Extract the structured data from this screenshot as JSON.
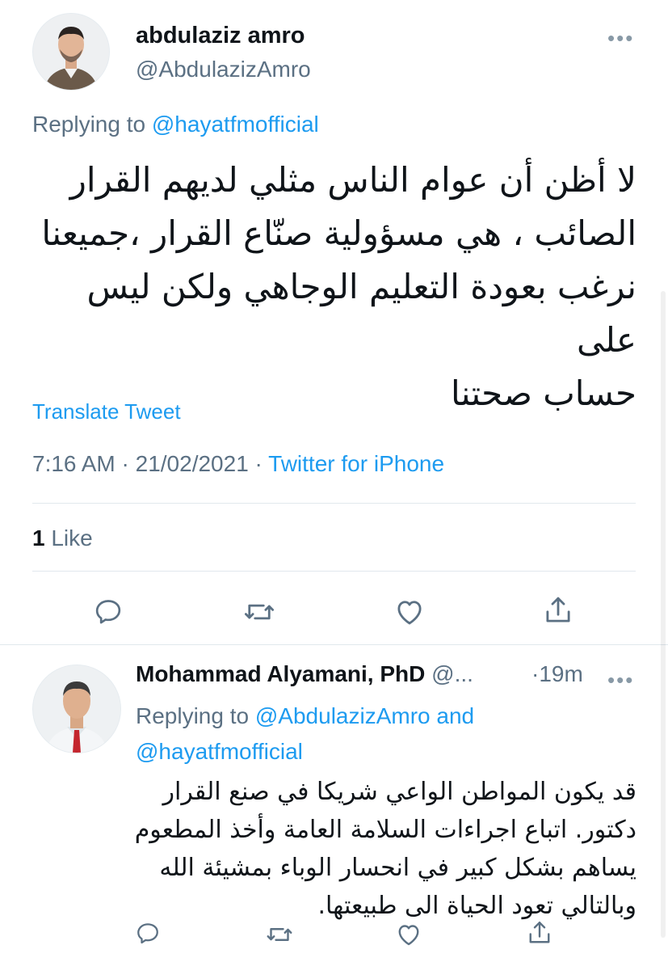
{
  "tweet": {
    "author_name": "abdulaziz amro",
    "author_handle": "@AbdulazizAmro",
    "more_label": "•••",
    "replying_prefix": "Replying to",
    "replying_to": "@hayatfmofficial",
    "text_lines": [
      "لا أظن أن عوام الناس مثلي لديهم القرار",
      "الصائب ، هي مسؤولية صنّاع القرار ،جميعنا",
      "نرغب بعودة التعليم الوجاهي ولكن ليس على",
      "حساب صحتنا"
    ],
    "translate_label": "Translate Tweet",
    "time": "7:16 AM",
    "separator": "·",
    "date": "21/02/2021",
    "source": "Twitter for iPhone",
    "likes_count": "1",
    "likes_label": "Like"
  },
  "reply": {
    "author_name": "Mohammad Alyamani, PhD",
    "author_handle_truncated": "@...",
    "time_sep": "·",
    "time": "19m",
    "more_label": "•••",
    "replying_prefix": "Replying to",
    "replying_to_1": "@AbdulazizAmro",
    "replying_and": "and",
    "replying_to_2": "@hayatfmofficial",
    "text_lines": [
      "قد يكون المواطن الواعي شريكا في صنع القرار",
      "دكتور. اتباع اجراءات السلامة العامة وأخذ المطعوم",
      "يساهم بشكل كبير في انحسار الوباء بمشيئة الله",
      "وبالتالي تعود الحياة الى طبيعتها."
    ]
  },
  "colors": {
    "link": "#1d9bf0",
    "muted": "#5b7083",
    "icon": "#5b7083",
    "divider": "#e1e8ed",
    "text": "#0f1419"
  },
  "icons": [
    "reply-icon",
    "retweet-icon",
    "like-icon",
    "share-icon"
  ]
}
